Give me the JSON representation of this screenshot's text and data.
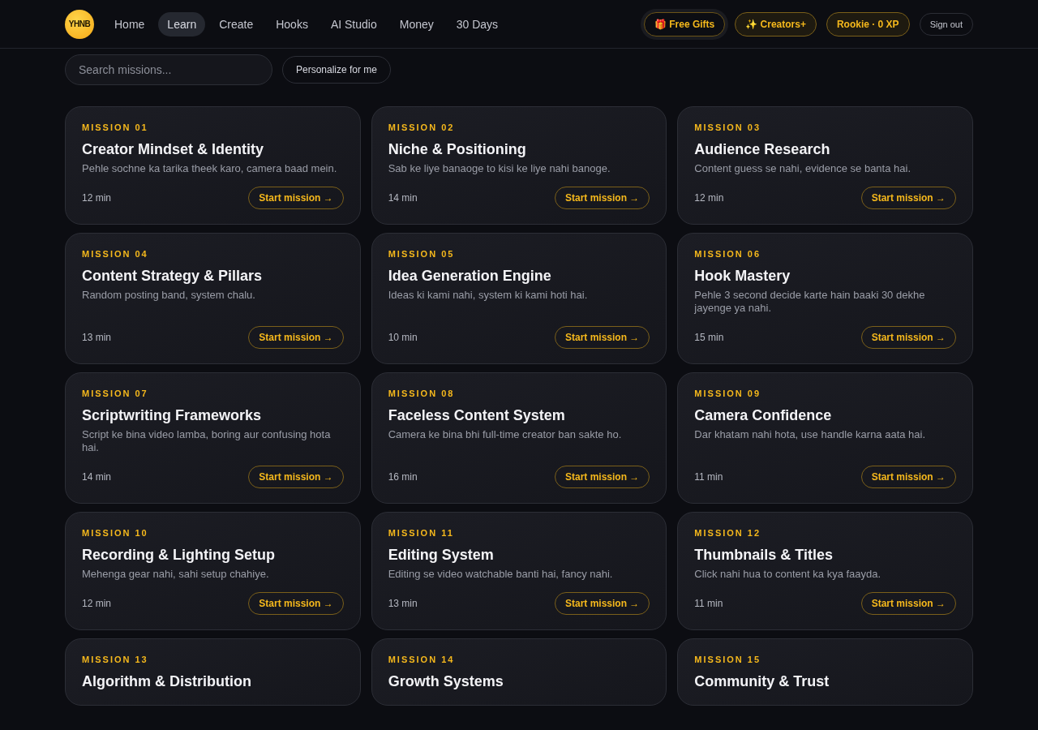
{
  "brand": {
    "logo": "YHNB"
  },
  "nav": [
    {
      "label": "Home",
      "selected": false
    },
    {
      "label": "Learn",
      "selected": true
    },
    {
      "label": "Create",
      "selected": false
    },
    {
      "label": "Hooks",
      "selected": false
    },
    {
      "label": "AI Studio",
      "selected": false
    },
    {
      "label": "Money",
      "selected": false
    },
    {
      "label": "30 Days",
      "selected": false
    }
  ],
  "header_actions": [
    {
      "kind": "gift",
      "label": "🎁 Free Gifts"
    },
    {
      "kind": "gold",
      "label": "✨ Creators+"
    },
    {
      "kind": "gold",
      "label": "Rookie · 0 XP"
    },
    {
      "kind": "plain",
      "label": "Sign out"
    }
  ],
  "search": {
    "placeholder": "Search missions..."
  },
  "personalize_button": "Personalize for me",
  "missions": [
    {
      "number": "MISSION 01",
      "title": "Creator Mindset & Identity",
      "description": "Pehle sochne ka tarika theek karo, camera baad mein.",
      "duration": "12 min",
      "action": "Start mission →"
    },
    {
      "number": "MISSION 02",
      "title": "Niche & Positioning",
      "description": "Sab ke liye banaoge to kisi ke liye nahi banoge.",
      "duration": "14 min",
      "action": "Start mission →"
    },
    {
      "number": "MISSION 03",
      "title": "Audience Research",
      "description": "Content guess se nahi, evidence se banta hai.",
      "duration": "12 min",
      "action": "Start mission →"
    },
    {
      "number": "MISSION 04",
      "title": "Content Strategy & Pillars",
      "description": "Random posting band, system chalu.",
      "duration": "13 min",
      "action": "Start mission →"
    },
    {
      "number": "MISSION 05",
      "title": "Idea Generation Engine",
      "description": "Ideas ki kami nahi, system ki kami hoti hai.",
      "duration": "10 min",
      "action": "Start mission →"
    },
    {
      "number": "MISSION 06",
      "title": "Hook Mastery",
      "description": "Pehle 3 second decide karte hain baaki 30 dekhe jayenge ya nahi.",
      "duration": "15 min",
      "action": "Start mission →"
    },
    {
      "number": "MISSION 07",
      "title": "Scriptwriting Frameworks",
      "description": "Script ke bina video lamba, boring aur confusing hota hai.",
      "duration": "14 min",
      "action": "Start mission →"
    },
    {
      "number": "MISSION 08",
      "title": "Faceless Content System",
      "description": "Camera ke bina bhi full-time creator ban sakte ho.",
      "duration": "16 min",
      "action": "Start mission →"
    },
    {
      "number": "MISSION 09",
      "title": "Camera Confidence",
      "description": "Dar khatam nahi hota, use handle karna aata hai.",
      "duration": "11 min",
      "action": "Start mission →"
    },
    {
      "number": "MISSION 10",
      "title": "Recording & Lighting Setup",
      "description": "Mehenga gear nahi, sahi setup chahiye.",
      "duration": "12 min",
      "action": "Start mission →"
    },
    {
      "number": "MISSION 11",
      "title": "Editing System",
      "description": "Editing se video watchable banti hai, fancy nahi.",
      "duration": "13 min",
      "action": "Start mission →"
    },
    {
      "number": "MISSION 12",
      "title": "Thumbnails & Titles",
      "description": "Click nahi hua to content ka kya faayda.",
      "duration": "11 min",
      "action": "Start mission →"
    },
    {
      "number": "MISSION 13",
      "title": "Algorithm & Distribution"
    },
    {
      "number": "MISSION 14",
      "title": "Growth Systems"
    },
    {
      "number": "MISSION 15",
      "title": "Community & Trust"
    }
  ]
}
